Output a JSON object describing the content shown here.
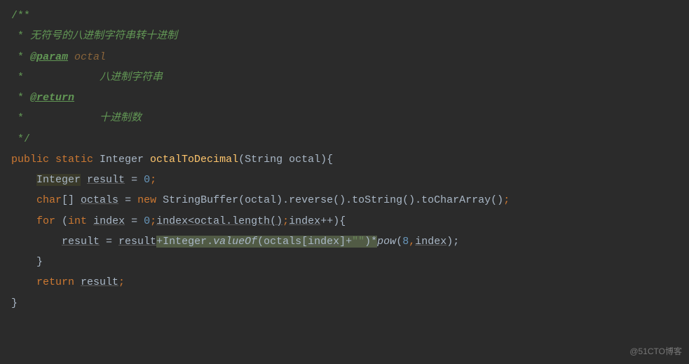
{
  "lines": {
    "l1": "/**",
    "l2_star": " * ",
    "l2_txt": "无符号的八进制字符串转十进制",
    "l3_star": " * ",
    "l3_tag": "@param",
    "l3_param": " octal",
    "l4_star": " *            ",
    "l4_txt": "八进制字符串",
    "l5_star": " * ",
    "l5_tag": "@return",
    "l6_star": " *            ",
    "l6_txt": "十进制数",
    "l7": " */",
    "l8_kw1": "public ",
    "l8_kw2": "static ",
    "l8_type": "Integer ",
    "l8_fn": "octalToDecimal",
    "l8_rest": "(String octal){",
    "l9_pad": "    ",
    "l9_int": "Integer",
    "l9_mid1": " ",
    "l9_res": "result",
    "l9_mid2": " = ",
    "l9_zero": "0",
    "l9_semi": ";",
    "l10_pad": "    ",
    "l10_kw1": "char",
    "l10_arr": "[] ",
    "l10_oct": "octals",
    "l10_eq": " = ",
    "l10_new": "new ",
    "l10_rest": "StringBuffer(octal).reverse().toString().toCharArray()",
    "l10_semi": ";",
    "l11_pad": "    ",
    "l11_for": "for ",
    "l11_op": "(",
    "l11_int": "int ",
    "l11_idx1": "index",
    "l11_eq": " = ",
    "l11_z": "0",
    "l11_s1": ";",
    "l11_mid": "index<octal.length()",
    "l11_s2": ";",
    "l11_idx2": "index",
    "l11_pp": "++){",
    "l12_pad": "        ",
    "l12_r1": "result",
    "l12_eq": " = ",
    "l12_r2": "result",
    "l12_plus": "+Integer.",
    "l12_vo": "valueOf",
    "l12_po": "(octals[",
    "l12_idx": "index",
    "l12_pc": "]+",
    "l12_str": "\"\"",
    "l12_cp": ")*",
    "l12_pow": "pow",
    "l12_pa": "(",
    "l12_8": "8",
    "l12_cm": ",",
    "l12_idx2": "index",
    "l12_end": ");",
    "l13": "    }",
    "l14_pad": "    ",
    "l14_ret": "return ",
    "l14_res": "result",
    "l14_s": ";",
    "l15": "}"
  },
  "watermark": "@51CTO博客"
}
